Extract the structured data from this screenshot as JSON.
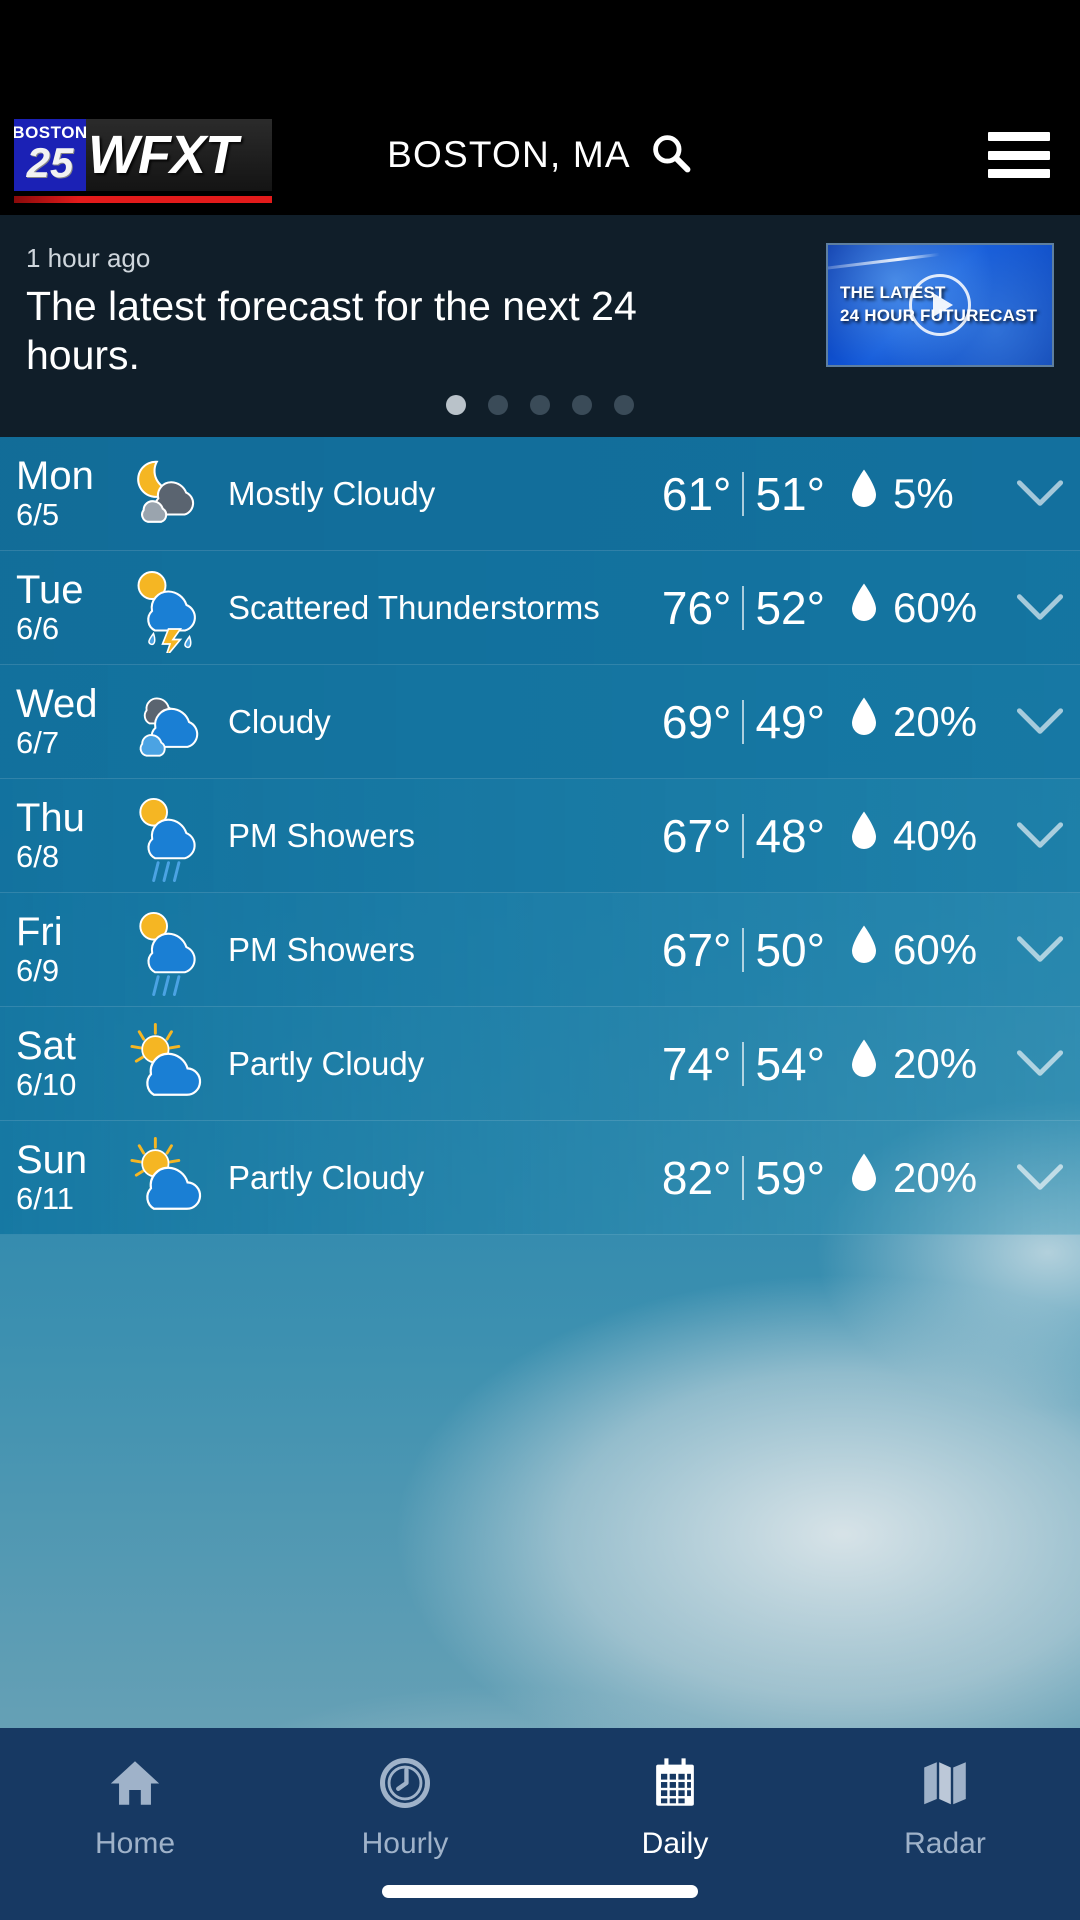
{
  "header": {
    "logo": {
      "boston": "BOSTON",
      "number": "25",
      "callsign": "WFXT"
    },
    "location": "BOSTON, MA",
    "search_icon": "search-icon",
    "menu_icon": "hamburger-menu-icon"
  },
  "news": {
    "timestamp": "1 hour ago",
    "headline": "The latest forecast for the next 24 hours.",
    "thumbnail": {
      "line1": "THE LATEST",
      "line2": "24 HOUR FUTURECAST",
      "play_icon": "play-icon"
    },
    "dots": {
      "count": 5,
      "active_index": 0
    }
  },
  "forecast": {
    "rows": [
      {
        "day": "Mon",
        "date": "6/5",
        "icon": "moon-behind-cloud-icon",
        "condition": "Mostly Cloudy",
        "high": "61°",
        "low": "51°",
        "precip": "5%"
      },
      {
        "day": "Tue",
        "date": "6/6",
        "icon": "thunderstorm-icon",
        "condition": "Scattered Thunderstorms",
        "high": "76°",
        "low": "52°",
        "precip": "60%"
      },
      {
        "day": "Wed",
        "date": "6/7",
        "icon": "cloudy-icon",
        "condition": "Cloudy",
        "high": "69°",
        "low": "49°",
        "precip": "20%"
      },
      {
        "day": "Thu",
        "date": "6/8",
        "icon": "sun-cloud-rain-icon",
        "condition": "PM Showers",
        "high": "67°",
        "low": "48°",
        "precip": "40%"
      },
      {
        "day": "Fri",
        "date": "6/9",
        "icon": "sun-cloud-rain-icon",
        "condition": "PM Showers",
        "high": "67°",
        "low": "50°",
        "precip": "60%"
      },
      {
        "day": "Sat",
        "date": "6/10",
        "icon": "sun-behind-cloud-icon",
        "condition": "Partly Cloudy",
        "high": "74°",
        "low": "54°",
        "precip": "20%"
      },
      {
        "day": "Sun",
        "date": "6/11",
        "icon": "sun-behind-cloud-icon",
        "condition": "Partly Cloudy",
        "high": "82°",
        "low": "59°",
        "precip": "20%"
      }
    ],
    "expand_icon": "chevron-down-icon",
    "precip_icon": "water-drop-icon"
  },
  "tabbar": {
    "items": [
      {
        "label": "Home",
        "icon": "home-icon",
        "active": false
      },
      {
        "label": "Hourly",
        "icon": "clock-icon",
        "active": false
      },
      {
        "label": "Daily",
        "icon": "calendar-icon",
        "active": true
      },
      {
        "label": "Radar",
        "icon": "map-icon",
        "active": false
      }
    ]
  },
  "colors": {
    "header_bg": "#000000",
    "news_bg": "#101e29",
    "row_blue": "#12709d",
    "tabbar_bg": "#173963",
    "accent_red": "#e31b1b",
    "logo_blue": "#1b21b5",
    "sun_yellow": "#f5b623",
    "cloud_blue": "#1a7fd4"
  }
}
